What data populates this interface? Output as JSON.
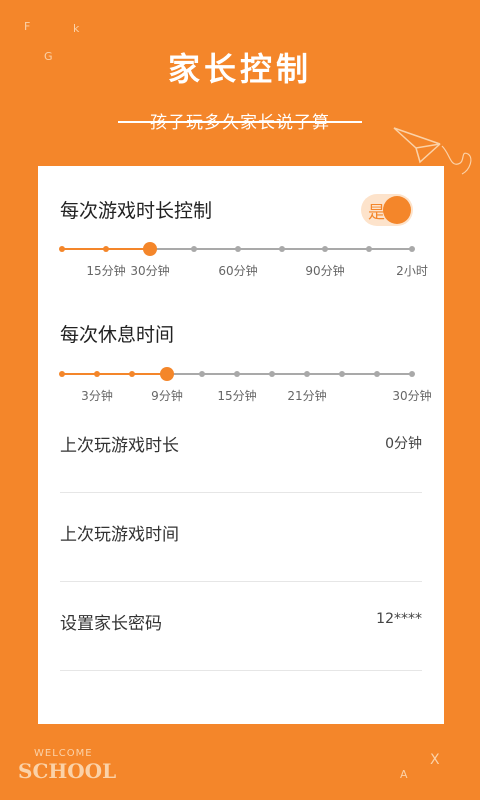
{
  "header": {
    "title": "家长控制",
    "subtitle": "孩子玩多久家长说了算"
  },
  "decor": {
    "letters_top": [
      "F",
      "k",
      "G"
    ],
    "letters_bottom": [
      "X",
      "A"
    ],
    "welcome": "WELCOME",
    "school": "SCHOOL"
  },
  "game_duration": {
    "title": "每次游戏时长控制",
    "toggle_label": "是",
    "toggle_on": true,
    "tick_labels": [
      "15分钟",
      "30分钟",
      "60分钟",
      "90分钟",
      "2小时"
    ],
    "selected_label": "30分钟"
  },
  "rest_time": {
    "title": "每次休息时间",
    "tick_labels": [
      "3分钟",
      "9分钟",
      "15分钟",
      "21分钟",
      "30分钟"
    ],
    "selected_label": "9分钟"
  },
  "rows": [
    {
      "label": "上次玩游戏时长",
      "value": "0分钟"
    },
    {
      "label": "上次玩游戏时间",
      "value": ""
    },
    {
      "label": "设置家长密码",
      "value": "12****"
    }
  ],
  "colors": {
    "accent": "#f4862a",
    "track_gray": "#a9a9a9",
    "background": "#f4862a"
  }
}
